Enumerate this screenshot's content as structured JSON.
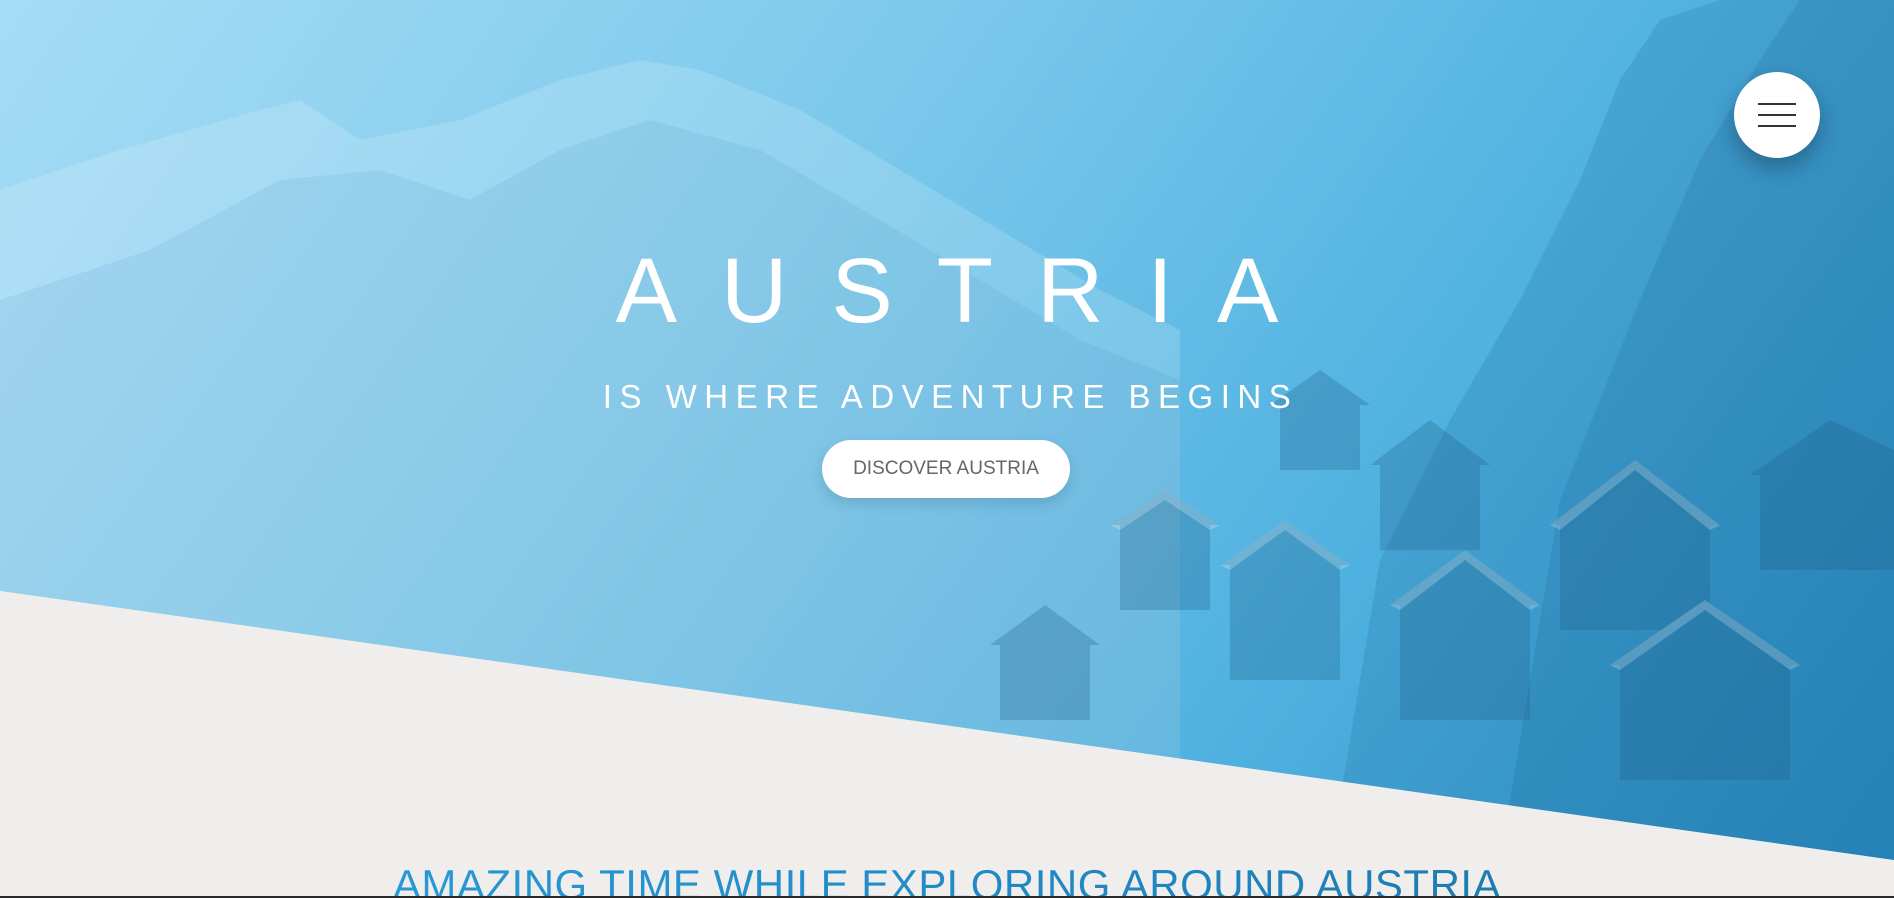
{
  "hero": {
    "title": "AUSTRIA",
    "subtitle": "IS WHERE ADVENTURE BEGINS",
    "cta_label": "DISCOVER AUSTRIA"
  },
  "menu": {
    "icon": "hamburger-menu-icon"
  },
  "section": {
    "heading": "AMAZING TIME WHILE EXPLORING AROUND AUSTRIA"
  },
  "colors": {
    "hero_gradient_start": "#a6dcf5",
    "hero_gradient_end": "#2b92c8",
    "page_background": "#f0eded",
    "heading_accent": "#2a9ad8",
    "button_background": "#ffffff",
    "button_text": "#666666"
  }
}
